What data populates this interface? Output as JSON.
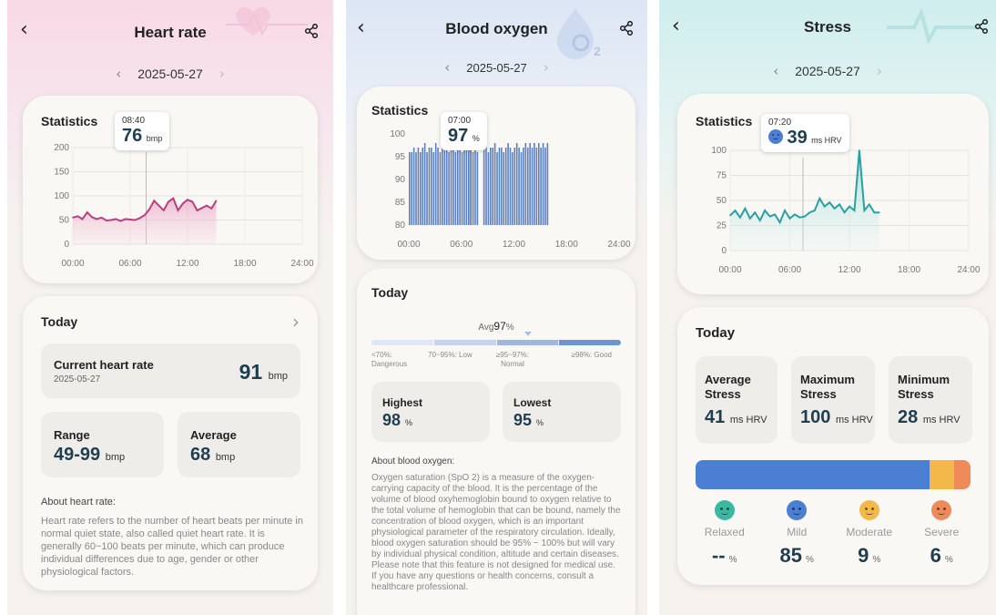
{
  "heart": {
    "title": "Heart rate",
    "date": "2025-05-27",
    "stats_title": "Statistics",
    "tooltip": {
      "time": "08:40",
      "value": "76",
      "unit": "bmp"
    },
    "y_ticks": [
      "200",
      "150",
      "100",
      "50",
      "0"
    ],
    "x_ticks": [
      "00:00",
      "06:00",
      "12:00",
      "18:00",
      "24:00"
    ],
    "today_title": "Today",
    "current_label": "Current heart rate",
    "current_date": "2025-05-27",
    "current_value": "91",
    "current_unit": "bmp",
    "range_label": "Range",
    "range_value": "49-99",
    "range_unit": "bmp",
    "average_label": "Average",
    "average_value": "68",
    "average_unit": "bmp",
    "about_title": "About heart rate:",
    "about_text": "Heart rate refers to the number of heart beats per minute in normal quiet state, also called quiet heart rate. It is generally 60~100 beats per minute, which can produce individual differences due to age, gender or other physiological factors.",
    "accent": "#b8407e"
  },
  "oxygen": {
    "title": "Blood oxygen",
    "date": "2025-05-27",
    "stats_title": "Statistics",
    "tooltip": {
      "time": "07:00",
      "value": "97",
      "unit": "%"
    },
    "y_ticks": [
      "100",
      "95",
      "90",
      "85",
      "80"
    ],
    "x_ticks": [
      "00:00",
      "06:00",
      "12:00",
      "18:00",
      "24:00"
    ],
    "today_title": "Today",
    "avg_prefix": "Avg",
    "avg_value": "97",
    "avg_unit": "%",
    "scale_labels": [
      "<70%: Dangerous",
      "70~95%: Low",
      "≥95~97%: Normal",
      "≥98%: Good"
    ],
    "highest_label": "Highest",
    "highest_value": "98",
    "lowest_label": "Lowest",
    "lowest_value": "95",
    "unit": "%",
    "about_title": "About blood oxygen:",
    "about_text": "Oxygen saturation (SpO 2) is a measure of the oxygen-carrying capacity of the blood. It is the percentage of the volume of blood oxyhemoglobin bound to oxygen relative to the total volume of hemoglobin that can be bound, namely the concentration of blood oxygen, which is an important physiological parameter of the respiratory circulation. Ideally, blood oxygen saturation should be 95% ~ 100% but will vary by individual physical condition, altitude and certain diseases. Please note that this feature is not designed for medical use. If you have any questions or health concerns, consult a healthcare professional.",
    "accent": "#5b7fc0"
  },
  "stress": {
    "title": "Stress",
    "date": "2025-05-27",
    "stats_title": "Statistics",
    "tooltip": {
      "time": "07:20",
      "value": "39",
      "unit": "ms HRV"
    },
    "y_ticks": [
      "100",
      "75",
      "50",
      "25",
      "0"
    ],
    "x_ticks": [
      "00:00",
      "06:00",
      "12:00",
      "18:00",
      "24:00"
    ],
    "today_title": "Today",
    "avg_label_1": "Average",
    "avg_label_2": "Stress",
    "avg_value": "41",
    "max_label_1": "Maximum",
    "max_label_2": "Stress",
    "max_value": "100",
    "min_label_1": "Minimum",
    "min_label_2": "Stress",
    "min_value": "28",
    "unit": "ms HRV",
    "levels": [
      {
        "label": "Relaxed",
        "value": "--",
        "unit": "%",
        "color": "#3cb8a0"
      },
      {
        "label": "Mild",
        "value": "85",
        "unit": "%",
        "color": "#4a7fd4"
      },
      {
        "label": "Moderate",
        "value": "9",
        "unit": "%",
        "color": "#f3b84a"
      },
      {
        "label": "Severe",
        "value": "6",
        "unit": "%",
        "color": "#ef8a5a"
      }
    ],
    "accent": "#2aa0a0"
  },
  "chart_data": [
    {
      "type": "line",
      "title": "Statistics",
      "x_ticks": [
        "00:00",
        "06:00",
        "12:00",
        "18:00",
        "24:00"
      ],
      "ylim": [
        0,
        200
      ],
      "x_hours": [
        0,
        0.5,
        1,
        1.5,
        2,
        2.5,
        3,
        3.5,
        4,
        4.5,
        5,
        5.5,
        6,
        6.5,
        7,
        7.5,
        8,
        8.5,
        9,
        9.5,
        10,
        10.5,
        11,
        11.5,
        12,
        12.5,
        13,
        13.5,
        14,
        14.5,
        15
      ],
      "values": [
        55,
        58,
        52,
        66,
        56,
        52,
        55,
        49,
        50,
        52,
        48,
        52,
        51,
        50,
        54,
        60,
        72,
        90,
        80,
        70,
        88,
        95,
        70,
        84,
        92,
        88,
        70,
        75,
        80,
        74,
        90
      ]
    },
    {
      "type": "bar",
      "title": "Statistics",
      "x_ticks": [
        "00:00",
        "06:00",
        "12:00",
        "18:00",
        "24:00"
      ],
      "ylim": [
        80,
        100
      ],
      "x_hours": [
        0,
        0.25,
        0.5,
        0.75,
        1,
        1.25,
        1.5,
        1.75,
        2,
        2.25,
        2.5,
        2.75,
        3,
        3.25,
        3.5,
        3.75,
        4,
        4.25,
        4.5,
        4.75,
        5,
        5.25,
        5.5,
        5.75,
        6,
        6.25,
        6.5,
        6.75,
        7,
        7.25,
        7.5,
        7.75,
        8.5,
        8.75,
        9,
        9.25,
        9.5,
        9.75,
        10,
        10.25,
        10.5,
        10.75,
        11,
        11.25,
        11.5,
        11.75,
        12,
        12.25,
        12.5,
        12.75,
        13,
        13.25,
        13.5,
        13.75,
        14,
        14.25,
        14.5,
        14.75,
        15,
        15.25,
        15.5,
        15.75
      ],
      "values": [
        96,
        96,
        97,
        96,
        97,
        96,
        97,
        98,
        96,
        97,
        97,
        96,
        98,
        97,
        96,
        97,
        97,
        98,
        96,
        97,
        97,
        96,
        98,
        97,
        96,
        97,
        98,
        97,
        97,
        96,
        97,
        96,
        97,
        98,
        96,
        97,
        97,
        98,
        96,
        97,
        97,
        96,
        97,
        98,
        97,
        96,
        97,
        98,
        97,
        96,
        97,
        98,
        97,
        98,
        97,
        98,
        97,
        98,
        97,
        98,
        97,
        98
      ]
    },
    {
      "type": "area",
      "title": "Statistics",
      "x_ticks": [
        "00:00",
        "06:00",
        "12:00",
        "18:00",
        "24:00"
      ],
      "ylim": [
        0,
        100
      ],
      "x_hours": [
        0,
        0.5,
        1,
        1.5,
        2,
        2.5,
        3,
        3.5,
        4,
        4.5,
        5,
        5.5,
        6,
        6.5,
        7,
        7.5,
        8,
        8.5,
        9,
        9.5,
        10,
        10.5,
        11,
        11.5,
        12,
        12.5,
        13,
        13.5,
        14,
        14.5,
        15
      ],
      "values": [
        35,
        40,
        33,
        42,
        32,
        38,
        30,
        40,
        34,
        36,
        28,
        40,
        32,
        36,
        33,
        34,
        38,
        40,
        52,
        44,
        48,
        42,
        46,
        38,
        44,
        40,
        100,
        40,
        46,
        38,
        38
      ]
    }
  ]
}
